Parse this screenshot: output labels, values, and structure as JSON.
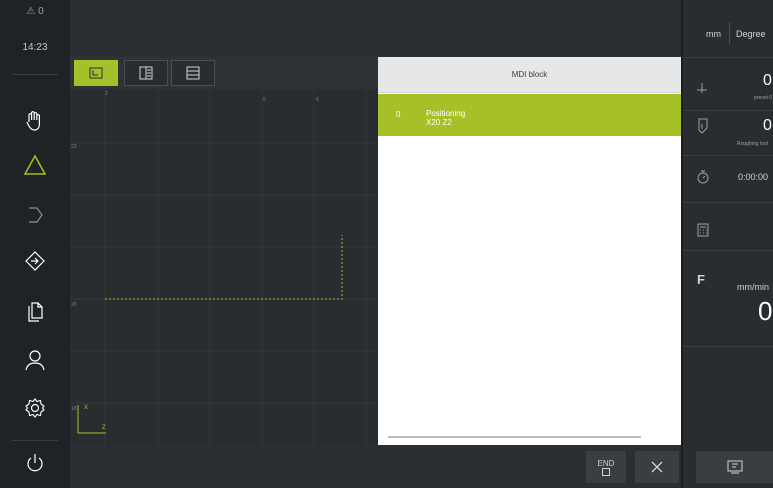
{
  "sidebar": {
    "warning_count": "⚠ 0",
    "time": "14:23",
    "items": [
      {
        "name": "manual-mode",
        "icon": "hand-icon"
      },
      {
        "name": "mdi-mode",
        "icon": "triangle-icon",
        "active": true
      },
      {
        "name": "program-run",
        "icon": "program-run-icon"
      },
      {
        "name": "program-create",
        "icon": "arrow-diamond-icon"
      },
      {
        "name": "file-management",
        "icon": "files-icon"
      },
      {
        "name": "user-login",
        "icon": "user-icon"
      },
      {
        "name": "settings",
        "icon": "gear-icon"
      },
      {
        "name": "power",
        "icon": "power-icon"
      }
    ]
  },
  "graphic": {
    "views": [
      {
        "icon": "graphic-view-icon",
        "active": true
      },
      {
        "icon": "split-view-icon",
        "active": false
      },
      {
        "icon": "list-view-icon",
        "active": false
      }
    ],
    "x_labels": [
      "2",
      "5",
      "6"
    ],
    "y_labels": [
      "23",
      "20",
      "18"
    ],
    "axis_x": "X",
    "axis_z": "Z"
  },
  "mdi": {
    "title": "MDI block",
    "rows": [
      {
        "number": "0",
        "line1": "Positioning",
        "line2": "X20 Z2"
      }
    ]
  },
  "bottom": {
    "end_label": "END",
    "close_icon": "close-icon"
  },
  "right": {
    "unit_length": "mm",
    "unit_angle": "Degree",
    "preset_value": "0",
    "preset_label": "preset 0",
    "tool_value": "0",
    "tool_label": "Roughing tool",
    "timer_value": "0:00:00",
    "feed_letter": "F",
    "feed_unit": "mm/min",
    "feed_value": "0"
  },
  "colors": {
    "accent": "#a6c02a",
    "background": "#1c1c1c",
    "panel": "#2a2d2f"
  }
}
